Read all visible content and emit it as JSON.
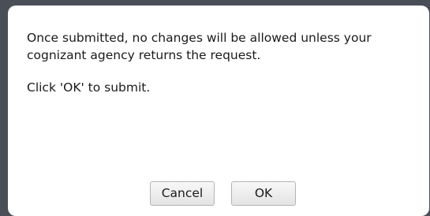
{
  "dialog": {
    "message_line1": "Once submitted, no changes will be allowed unless your cognizant agency returns the request.",
    "message_line2": "Click 'OK' to submit.",
    "cancel_label": "Cancel",
    "ok_label": "OK"
  }
}
